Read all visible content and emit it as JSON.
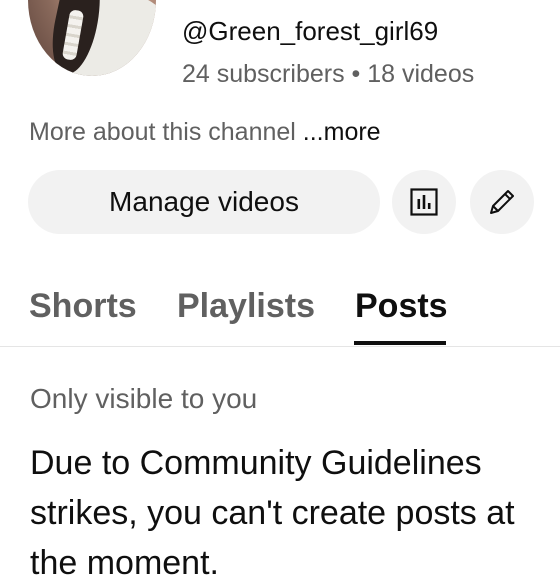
{
  "channel": {
    "handle": "@Green_forest_girl69",
    "stats": "24 subscribers • 18 videos",
    "about_text": "More about this channel ",
    "about_more": "...more"
  },
  "actions": {
    "manage_videos_label": "Manage videos",
    "analytics_icon": "analytics-icon",
    "edit_icon": "pencil-icon"
  },
  "tabs": [
    {
      "label": "Shorts",
      "active": false
    },
    {
      "label": "Playlists",
      "active": false
    },
    {
      "label": "Posts",
      "active": true
    }
  ],
  "posts": {
    "visibility_note": "Only visible to you",
    "notice": "Due to Community Guidelines strikes, you can't create posts at the moment."
  },
  "colors": {
    "text_primary": "#0f0f0f",
    "text_secondary": "#606060",
    "button_bg": "#f2f2f2"
  }
}
